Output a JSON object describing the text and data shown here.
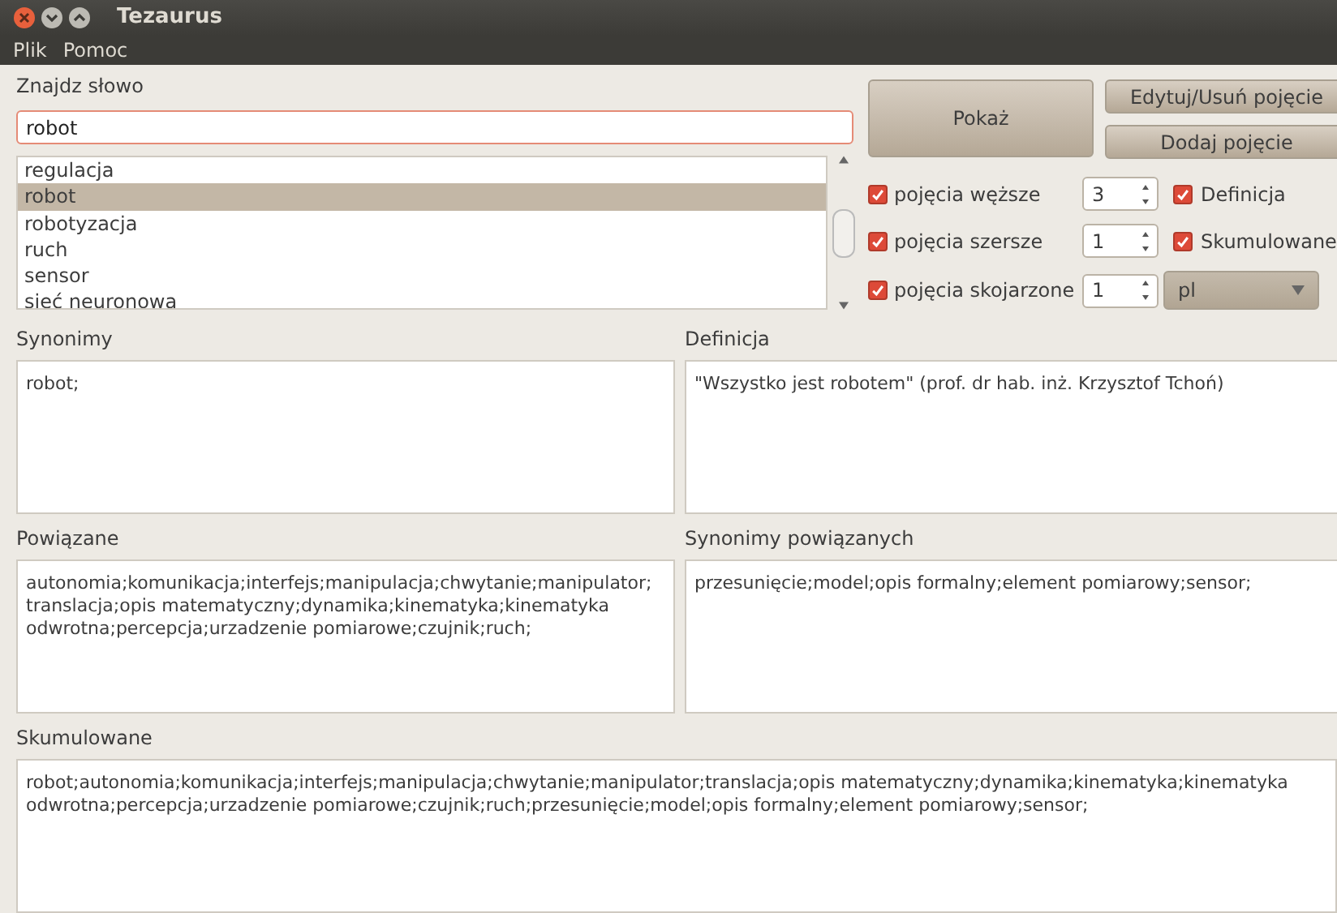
{
  "window": {
    "title": "Tezaurus"
  },
  "menu": [
    "Plik",
    "Pomoc"
  ],
  "search": {
    "label": "Znajdz słowo",
    "value": "robot"
  },
  "word_list": [
    {
      "label": "regulacja",
      "selected": false
    },
    {
      "label": "robot",
      "selected": true
    },
    {
      "label": "robotyzacja",
      "selected": false
    },
    {
      "label": "ruch",
      "selected": false
    },
    {
      "label": "sensor",
      "selected": false
    },
    {
      "label": "sieć neuronowa",
      "selected": false
    }
  ],
  "show_button": "Pokaż",
  "edit_button": "Edytuj/Usuń pojęcie",
  "add_button": "Dodaj pojęcie",
  "depth_options": [
    {
      "label": "pojęcia węższe",
      "checked": true,
      "value": "3"
    },
    {
      "label": "pojęcia szersze",
      "checked": true,
      "value": "1"
    },
    {
      "label": "pojęcia skojarzone",
      "checked": true,
      "value": "1"
    }
  ],
  "view_options": [
    {
      "label": "Definicja",
      "checked": true
    },
    {
      "label": "Skumulowane",
      "checked": true
    }
  ],
  "language": {
    "value": "pl"
  },
  "panels": [
    {
      "label": "Synonimy",
      "text": "robot;"
    },
    {
      "label": "Definicja",
      "text": "\"Wszystko jest robotem\" (prof. dr hab. inż. Krzysztof Tchoń)"
    },
    {
      "label": "Powiązane",
      "text": "autonomia;komunikacja;interfejs;manipulacja;chwytanie;manipulator; translacja;opis matematyczny;dynamika;kinematyka;kinematyka odwrotna;percepcja;urzadzenie pomiarowe;czujnik;ruch;"
    },
    {
      "label": "Synonimy powiązanych",
      "text": "przesunięcie;model;opis formalny;element pomiarowy;sensor;"
    },
    {
      "label": "Skumulowane",
      "text": "robot;autonomia;komunikacja;interfejs;manipulacja;chwytanie;manipulator;translacja;opis matematyczny;dynamika;kinematyka;kinematyka odwrotna;percepcja;urzadzenie pomiarowe;czujnik;ruch;przesunięcie;model;opis formalny;element pomiarowy;sensor;"
    }
  ]
}
